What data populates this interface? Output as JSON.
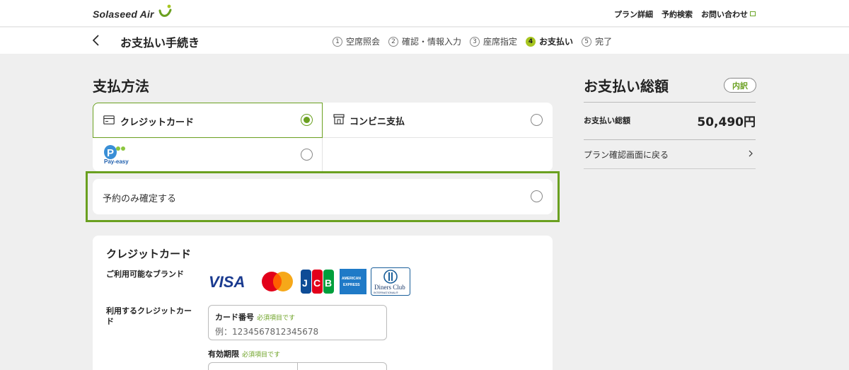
{
  "header": {
    "logo_text": "Solaseed Air",
    "links": [
      "プラン詳細",
      "予約検索",
      "お問い合わせ"
    ]
  },
  "nav": {
    "title": "お支払い手続き",
    "steps": [
      {
        "num": "1",
        "label": "空席照会"
      },
      {
        "num": "2",
        "label": "確認・情報入力"
      },
      {
        "num": "3",
        "label": "座席指定"
      },
      {
        "num": "4",
        "label": "お支払い"
      },
      {
        "num": "5",
        "label": "完了"
      }
    ],
    "active_step": 4
  },
  "payment": {
    "heading": "支払方法",
    "options": {
      "credit_card": "クレジットカード",
      "convenience": "コンビニ支払",
      "payeasy": "Pay-easy",
      "reserve_only": "予約のみ確定する"
    },
    "selected": "credit_card"
  },
  "summary": {
    "heading": "お支払い総額",
    "detail_button": "内訳",
    "total_label": "お支払い総額",
    "total_value": "50,490円",
    "back_link": "プラン確認画面に戻る"
  },
  "credit_card": {
    "heading": "クレジットカード",
    "brands_label": "ご利用可能なブランド",
    "brands": [
      "VISA",
      "Mastercard",
      "JCB",
      "American Express",
      "Diners Club International"
    ],
    "card_label": "利用するクレジットカード",
    "card_number_label": "カード番号",
    "required_text": "必須項目です",
    "card_number_placeholder": "例：1234567812345678",
    "expiry_label": "有効期限"
  },
  "colors": {
    "accent": "#6aa020",
    "step_active": "#a7c520",
    "background": "#efefef"
  }
}
